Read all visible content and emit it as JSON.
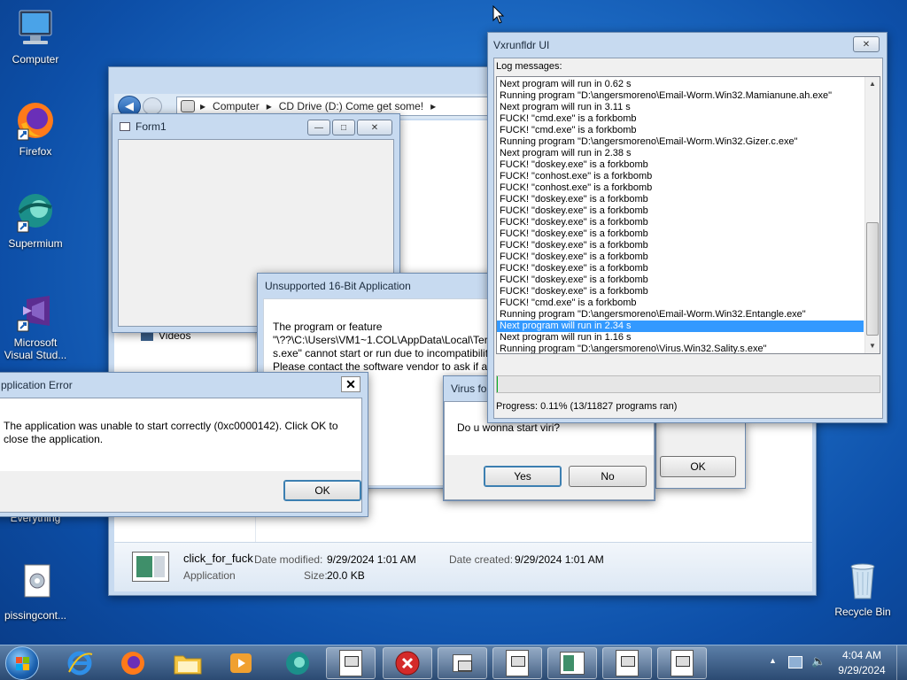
{
  "desktop": {
    "icons": [
      {
        "label": "Computer"
      },
      {
        "label": "Firefox"
      },
      {
        "label": "Supermium"
      },
      {
        "label": "Microsoft Visual Stud..."
      },
      {
        "label": "Everything"
      },
      {
        "label": "pissingcont..."
      },
      {
        "label": "Recycle Bin"
      }
    ]
  },
  "explorer": {
    "breadcrumb": [
      "Computer",
      "CD Drive (D:) Come get some!"
    ],
    "nav_item": "Videos",
    "details": {
      "filename": "click_for_fuck",
      "type": "Application",
      "modified_label": "Date modified:",
      "modified_value": "9/29/2024 1:01 AM",
      "created_label": "Date created:",
      "created_value": "9/29/2024 1:01 AM",
      "size_label": "Size:",
      "size_value": "20.0 KB"
    }
  },
  "form1": {
    "title": "Form1"
  },
  "unsupported": {
    "title": "Unsupported 16-Bit Application",
    "line1": "The program or feature",
    "line2": "\"\\??\\C:\\Users\\VM1~1.COL\\AppData\\Local\\Ter",
    "line3": "s.exe\" cannot start or run due to incompatibilit",
    "line4": "Please contact the software vendor to ask if a 6",
    "ok_label": "OK"
  },
  "app_error": {
    "title": "pplication Error",
    "message": "The application was unable to start correctly (0xc0000142). Click OK to close the application.",
    "ok_label": "OK"
  },
  "virus_dialog": {
    "title": "Virus for",
    "message": "Do u wonna start viri?",
    "yes_label": "Yes",
    "no_label": "No"
  },
  "vxrunfldr": {
    "title": "Vxrunfldr UI",
    "log_label": "Log messages:",
    "log": [
      "Next program will run in 0.62 s",
      "Running program \"D:\\angersmoreno\\Email-Worm.Win32.Mamianune.ah.exe\"",
      "Next program will run in 3.11 s",
      "FUCK! \"cmd.exe\" is a forkbomb",
      "FUCK! \"cmd.exe\" is a forkbomb",
      "Running program \"D:\\angersmoreno\\Email-Worm.Win32.Gizer.c.exe\"",
      "Next program will run in 2.38 s",
      "FUCK! \"doskey.exe\" is a forkbomb",
      "FUCK! \"conhost.exe\" is a forkbomb",
      "FUCK! \"conhost.exe\" is a forkbomb",
      "FUCK! \"doskey.exe\" is a forkbomb",
      "FUCK! \"doskey.exe\" is a forkbomb",
      "FUCK! \"doskey.exe\" is a forkbomb",
      "FUCK! \"doskey.exe\" is a forkbomb",
      "FUCK! \"doskey.exe\" is a forkbomb",
      "FUCK! \"doskey.exe\" is a forkbomb",
      "FUCK! \"doskey.exe\" is a forkbomb",
      "FUCK! \"doskey.exe\" is a forkbomb",
      "FUCK! \"doskey.exe\" is a forkbomb",
      "FUCK! \"cmd.exe\" is a forkbomb",
      "Running program \"D:\\angersmoreno\\Email-Worm.Win32.Entangle.exe\"",
      "Next program will run in 2.34 s",
      "Next program will run in 1.16 s",
      "Running program \"D:\\angersmoreno\\Virus.Win32.Sality.s.exe\""
    ],
    "selected_index": 21,
    "progress_fraction": 0.0011,
    "progress_text": "Progress: 0.11% (13/11827 programs ran)"
  },
  "back_dialog": {
    "ok_label": "OK"
  },
  "taskbar": {
    "time": "4:04 AM",
    "date": "9/29/2024"
  }
}
